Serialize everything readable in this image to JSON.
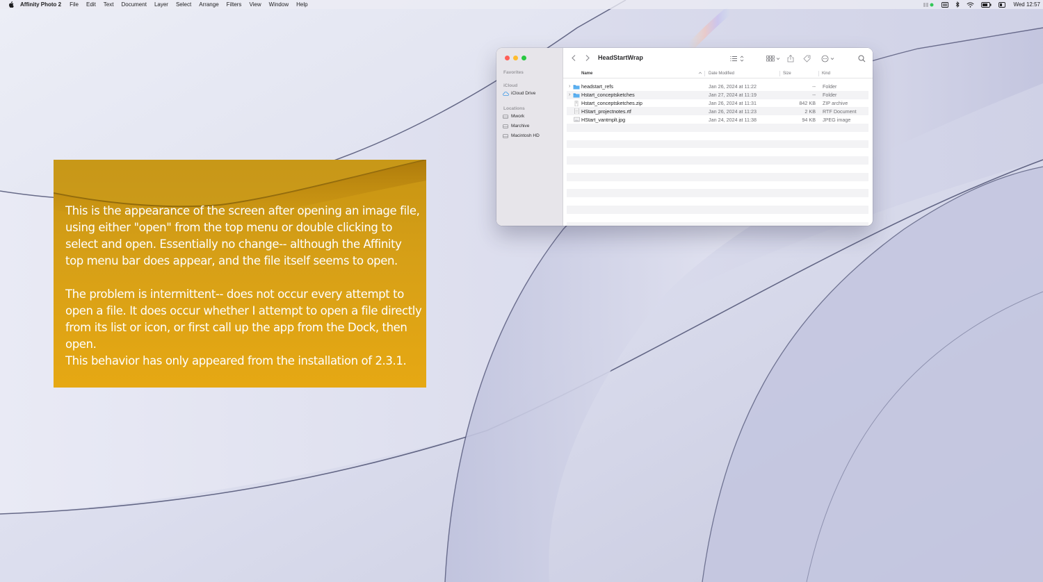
{
  "menubar": {
    "app_name": "Affinity Photo 2",
    "menus": [
      "File",
      "Edit",
      "Text",
      "Document",
      "Layer",
      "Select",
      "Arrange",
      "Filters",
      "View",
      "Window",
      "Help"
    ],
    "clock": "Wed 12:57"
  },
  "note": {
    "paragraph1": "This is the appearance of the screen after opening an image file,\nusing either \"open\" from the top menu or  double clicking to\nselect and open.  Essentially no change-- although the Affinity\ntop menu bar does appear, and the file itself seems to open.",
    "paragraph2": "The problem is intermittent-- does not occur every attempt to\nopen a file.  It does occur whether I attempt to open a file directly\nfrom its list or icon, or first call up the app from the Dock, then open.\nThis behavior has only appeared from the installation of 2.3.1."
  },
  "finder": {
    "title": "HeadStartWrap",
    "sidebar": {
      "favorites_header": "Favorites",
      "icloud_header": "iCloud",
      "icloud_drive": "iCloud Drive",
      "locations_header": "Locations",
      "locations": [
        "Mwork",
        "Marchive",
        "Macintosh HD"
      ]
    },
    "columns": {
      "name": "Name",
      "date": "Date Modified",
      "size": "Size",
      "kind": "Kind"
    },
    "files": [
      {
        "name": "headstart_refs",
        "date": "Jan 26, 2024 at 11:22",
        "size": "--",
        "kind": "Folder",
        "type": "folder"
      },
      {
        "name": "Hstart_conceptsketches",
        "date": "Jan 27, 2024 at 11:19",
        "size": "--",
        "kind": "Folder",
        "type": "folder"
      },
      {
        "name": "Hstart_conceptsketches.zip",
        "date": "Jan 26, 2024 at 11:31",
        "size": "842 KB",
        "kind": "ZIP archive",
        "type": "zip"
      },
      {
        "name": "HStart_projectnotes.rtf",
        "date": "Jan 26, 2024 at 11:23",
        "size": "2 KB",
        "kind": "RTF Document",
        "type": "doc"
      },
      {
        "name": "HStart_vantmplt.jpg",
        "date": "Jan 24, 2024 at 11:38",
        "size": "94 KB",
        "kind": "JPEG image",
        "type": "image"
      }
    ]
  },
  "colors": {
    "note_background": "#d7a017",
    "folder_blue": "#3f9ae6",
    "close": "#ff5f57",
    "minimize": "#febc2e",
    "zoom": "#28c840"
  }
}
